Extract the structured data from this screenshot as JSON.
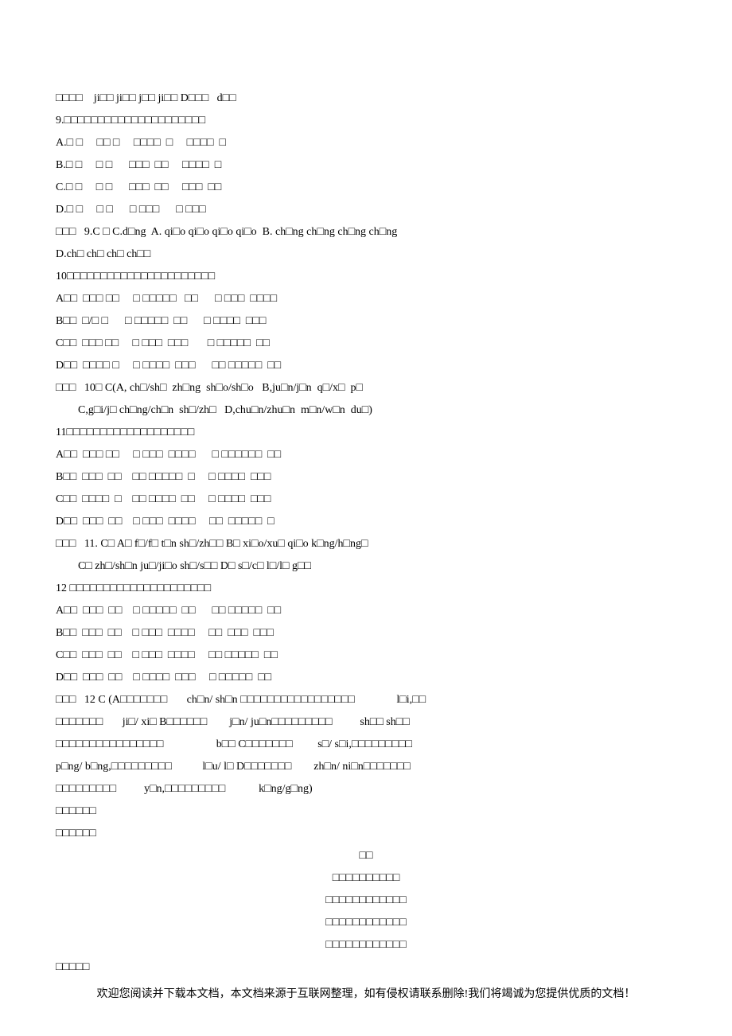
{
  "block1": {
    "l1": "□□□□    ji□□ ji□□ j□□ ji□□ D□□□   d□□"
  },
  "q9": {
    "stem": "9.□□□□□□□□□□□□□□□□□□□□□",
    "A": "A.□ □     □□ □     □□□□  □     □□□□  □",
    "B": "B.□ □     □ □      □□□  □□     □□□□  □",
    "C": "C.□ □     □ □      □□□  □□     □□□  □□",
    "D": "D.□ □     □ □      □ □□□      □ □□□",
    "ans": "□□□   9.C □ C.d□ng  A. qi□o qi□o qi□o qi□o  B. ch□ng ch□ng ch□ng ch□ng",
    "ans2": "D.ch□ ch□ ch□ ch□□"
  },
  "q10": {
    "stem": "10□□□□□□□□□□□□□□□□□□□□□□",
    "A": "A□□  □□□ □□     □ □□□□□   □□      □ □□□  □□□□",
    "B": "B□□  □/□ □      □ □□□□□  □□      □ □□□□  □□□",
    "C": "C□□  □□□ □□     □ □□□  □□□       □ □□□□□  □□",
    "D": "D□□  □□□□ □     □ □□□□  □□□      □□ □□□□□  □□",
    "ans": "□□□   10□ C(A, ch□/sh□  zh□ng  sh□o/sh□o   B,ju□n/j□n  q□/x□  p□",
    "ans2": "        C,g□i/j□ ch□ng/ch□n  sh□/zh□   D,chu□n/zhu□n  m□n/w□n  du□)"
  },
  "q11": {
    "stem": "11□□□□□□□□□□□□□□□□□□□",
    "A": "A□□  □□□ □□     □ □□□  □□□□      □ □□□□□□  □□",
    "B": "B□□  □□□  □□    □□ □□□□□  □     □ □□□□  □□□",
    "C": "C□□  □□□□  □    □□ □□□□  □□     □ □□□□  □□□",
    "D": "D□□  □□□  □□    □ □□□  □□□□     □□  □□□□□  □",
    "ans": "□□□   11. C□ A□ f□/f□ t□n sh□/zh□□ B□ xi□o/xu□ qi□o k□ng/h□ng□",
    "ans2": "        C□ zh□/sh□n ju□/ji□o sh□/s□□ D□ s□/c□ l□/l□ g□□"
  },
  "q12": {
    "stem": "12 □□□□□□□□□□□□□□□□□□□□□",
    "A": "A□□  □□□  □□    □ □□□□□  □□      □□ □□□□□  □□",
    "B": "B□□  □□□  □□    □ □□□  □□□□     □□  □□□  □□□",
    "C": "C□□  □□□  □□    □ □□□  □□□□     □□ □□□□□  □□",
    "D": "D□□  □□□  □□    □ □□□□  □□□     □ □□□□□  □□",
    "ans1": "□□□   12 C (A□□□□□□□       ch□n/ sh□n □□□□□□□□□□□□□□□□□               l□i,□□",
    "ans2": "□□□□□□□       ji□/ xi□ B□□□□□□        j□n/ ju□n□□□□□□□□□          sh□□ sh□□",
    "ans3": "□□□□□□□□□□□□□□□□                   b□□ C□□□□□□□         s□/ s□i,□□□□□□□□□",
    "ans4": "p□ng/ b□ng,□□□□□□□□□           l□u/ l□ D□□□□□□□        zh□n/ ni□n□□□□□□□",
    "ans5": "□□□□□□□□□          y□n,□□□□□□□□□            k□ng/g□ng)"
  },
  "tail": {
    "t1": "□□□□□□",
    "t2": "□□□□□□"
  },
  "center": {
    "c1": "□□",
    "c2": "□□□□□□□□□□",
    "c3": "□□□□□□□□□□□□",
    "c4": "□□□□□□□□□□□□",
    "c5": "□□□□□□□□□□□□"
  },
  "last": "□□□□□",
  "footer": "欢迎您阅读并下载本文档，本文档来源于互联网整理，如有侵权请联系删除!我们将竭诚为您提供优质的文档！"
}
